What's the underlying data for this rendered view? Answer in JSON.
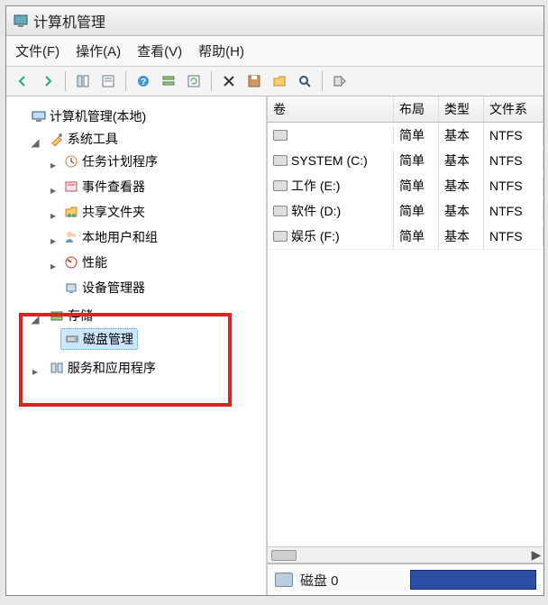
{
  "title": "计算机管理",
  "menu": {
    "file": "文件(F)",
    "action": "操作(A)",
    "view": "查看(V)",
    "help": "帮助(H)"
  },
  "tree": {
    "root": "计算机管理(本地)",
    "system_tools": "系统工具",
    "task_scheduler": "任务计划程序",
    "event_viewer": "事件查看器",
    "shared_folders": "共享文件夹",
    "local_users": "本地用户和组",
    "performance": "性能",
    "device_manager": "设备管理器",
    "storage": "存储",
    "disk_mgmt": "磁盘管理",
    "services_apps": "服务和应用程序"
  },
  "columns": {
    "volume": "卷",
    "layout": "布局",
    "type": "类型",
    "fs": "文件系"
  },
  "rows": [
    {
      "name": "",
      "layout": "简单",
      "type": "基本",
      "fs": "NTFS"
    },
    {
      "name": "SYSTEM (C:)",
      "layout": "简单",
      "type": "基本",
      "fs": "NTFS"
    },
    {
      "name": "工作 (E:)",
      "layout": "简单",
      "type": "基本",
      "fs": "NTFS"
    },
    {
      "name": "软件 (D:)",
      "layout": "简单",
      "type": "基本",
      "fs": "NTFS"
    },
    {
      "name": "娱乐 (F:)",
      "layout": "简单",
      "type": "基本",
      "fs": "NTFS"
    }
  ],
  "bottom": {
    "disk0": "磁盘 0"
  }
}
